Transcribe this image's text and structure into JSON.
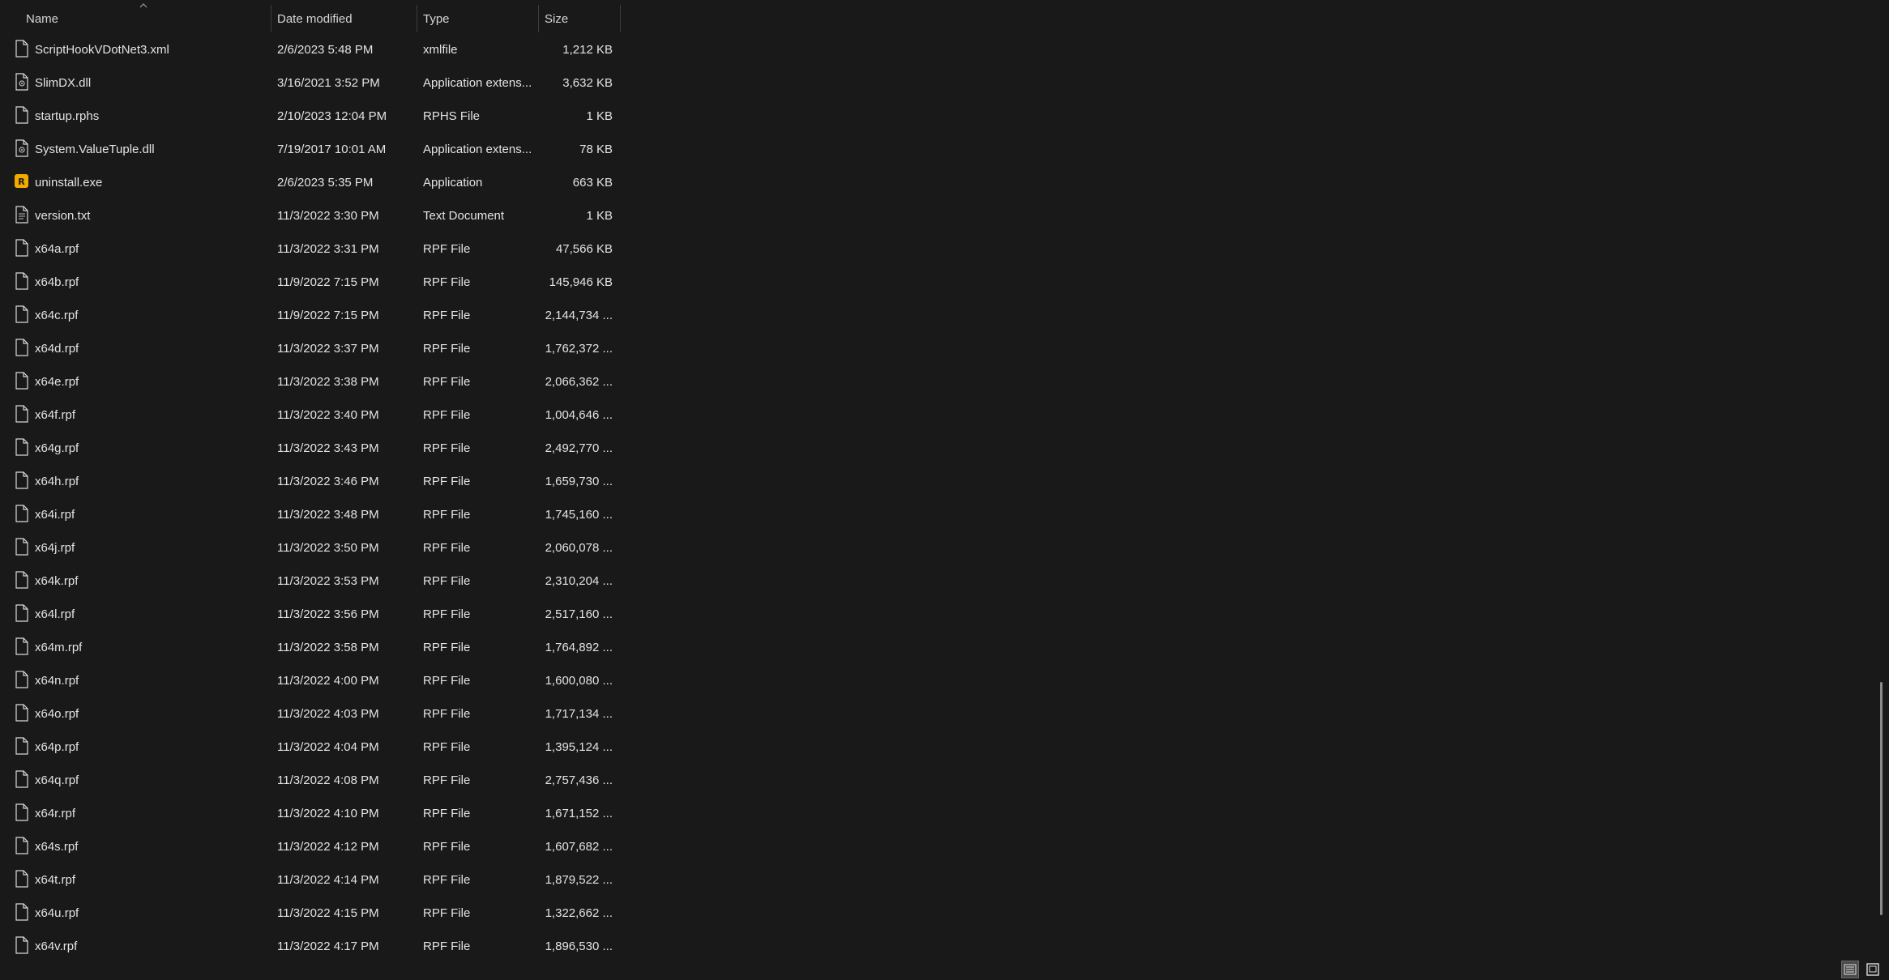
{
  "columns": {
    "name": "Name",
    "date": "Date modified",
    "type": "Type",
    "size": "Size"
  },
  "files": [
    {
      "name": "ScriptHookVDotNet3.xml",
      "date": "2/6/2023 5:48 PM",
      "type": "xmlfile",
      "size": "1,212 KB",
      "icon": "document-icon"
    },
    {
      "name": "SlimDX.dll",
      "date": "3/16/2021 3:52 PM",
      "type": "Application extens...",
      "size": "3,632 KB",
      "icon": "dll-file-icon"
    },
    {
      "name": "startup.rphs",
      "date": "2/10/2023 12:04 PM",
      "type": "RPHS File",
      "size": "1 KB",
      "icon": "document-icon"
    },
    {
      "name": "System.ValueTuple.dll",
      "date": "7/19/2017 10:01 AM",
      "type": "Application extens...",
      "size": "78 KB",
      "icon": "dll-file-icon"
    },
    {
      "name": "uninstall.exe",
      "date": "2/6/2023 5:35 PM",
      "type": "Application",
      "size": "663 KB",
      "icon": "rockstar-app-icon"
    },
    {
      "name": "version.txt",
      "date": "11/3/2022 3:30 PM",
      "type": "Text Document",
      "size": "1 KB",
      "icon": "text-file-icon"
    },
    {
      "name": "x64a.rpf",
      "date": "11/3/2022 3:31 PM",
      "type": "RPF File",
      "size": "47,566 KB",
      "icon": "document-icon"
    },
    {
      "name": "x64b.rpf",
      "date": "11/9/2022 7:15 PM",
      "type": "RPF File",
      "size": "145,946 KB",
      "icon": "document-icon"
    },
    {
      "name": "x64c.rpf",
      "date": "11/9/2022 7:15 PM",
      "type": "RPF File",
      "size": "2,144,734 ...",
      "icon": "document-icon"
    },
    {
      "name": "x64d.rpf",
      "date": "11/3/2022 3:37 PM",
      "type": "RPF File",
      "size": "1,762,372 ...",
      "icon": "document-icon"
    },
    {
      "name": "x64e.rpf",
      "date": "11/3/2022 3:38 PM",
      "type": "RPF File",
      "size": "2,066,362 ...",
      "icon": "document-icon"
    },
    {
      "name": "x64f.rpf",
      "date": "11/3/2022 3:40 PM",
      "type": "RPF File",
      "size": "1,004,646 ...",
      "icon": "document-icon"
    },
    {
      "name": "x64g.rpf",
      "date": "11/3/2022 3:43 PM",
      "type": "RPF File",
      "size": "2,492,770 ...",
      "icon": "document-icon"
    },
    {
      "name": "x64h.rpf",
      "date": "11/3/2022 3:46 PM",
      "type": "RPF File",
      "size": "1,659,730 ...",
      "icon": "document-icon"
    },
    {
      "name": "x64i.rpf",
      "date": "11/3/2022 3:48 PM",
      "type": "RPF File",
      "size": "1,745,160 ...",
      "icon": "document-icon"
    },
    {
      "name": "x64j.rpf",
      "date": "11/3/2022 3:50 PM",
      "type": "RPF File",
      "size": "2,060,078 ...",
      "icon": "document-icon"
    },
    {
      "name": "x64k.rpf",
      "date": "11/3/2022 3:53 PM",
      "type": "RPF File",
      "size": "2,310,204 ...",
      "icon": "document-icon"
    },
    {
      "name": "x64l.rpf",
      "date": "11/3/2022 3:56 PM",
      "type": "RPF File",
      "size": "2,517,160 ...",
      "icon": "document-icon"
    },
    {
      "name": "x64m.rpf",
      "date": "11/3/2022 3:58 PM",
      "type": "RPF File",
      "size": "1,764,892 ...",
      "icon": "document-icon"
    },
    {
      "name": "x64n.rpf",
      "date": "11/3/2022 4:00 PM",
      "type": "RPF File",
      "size": "1,600,080 ...",
      "icon": "document-icon"
    },
    {
      "name": "x64o.rpf",
      "date": "11/3/2022 4:03 PM",
      "type": "RPF File",
      "size": "1,717,134 ...",
      "icon": "document-icon"
    },
    {
      "name": "x64p.rpf",
      "date": "11/3/2022 4:04 PM",
      "type": "RPF File",
      "size": "1,395,124 ...",
      "icon": "document-icon"
    },
    {
      "name": "x64q.rpf",
      "date": "11/3/2022 4:08 PM",
      "type": "RPF File",
      "size": "2,757,436 ...",
      "icon": "document-icon"
    },
    {
      "name": "x64r.rpf",
      "date": "11/3/2022 4:10 PM",
      "type": "RPF File",
      "size": "1,671,152 ...",
      "icon": "document-icon"
    },
    {
      "name": "x64s.rpf",
      "date": "11/3/2022 4:12 PM",
      "type": "RPF File",
      "size": "1,607,682 ...",
      "icon": "document-icon"
    },
    {
      "name": "x64t.rpf",
      "date": "11/3/2022 4:14 PM",
      "type": "RPF File",
      "size": "1,879,522 ...",
      "icon": "document-icon"
    },
    {
      "name": "x64u.rpf",
      "date": "11/3/2022 4:15 PM",
      "type": "RPF File",
      "size": "1,322,662 ...",
      "icon": "document-icon"
    },
    {
      "name": "x64v.rpf",
      "date": "11/3/2022 4:17 PM",
      "type": "RPF File",
      "size": "1,896,530 ...",
      "icon": "document-icon"
    }
  ],
  "colors": {
    "background": "#191919",
    "text": "#e3e3e3",
    "rockstar_icon": "#f2a900"
  },
  "view_buttons": {
    "details_icon": "details-view-icon",
    "tiles_icon": "large-icons-view-icon"
  }
}
